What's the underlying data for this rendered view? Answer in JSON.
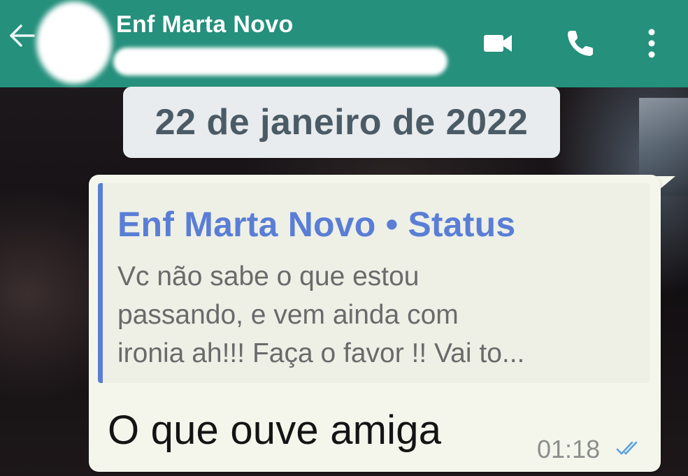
{
  "header": {
    "back_icon": "arrow-left-icon",
    "contact_name": "Enf Marta Novo",
    "actions": [
      {
        "name": "video-call",
        "icon": "video-camera-icon"
      },
      {
        "name": "voice-call",
        "icon": "phone-icon"
      },
      {
        "name": "more-options",
        "icon": "vertical-dots-icon"
      }
    ],
    "bar_color": "#25907c"
  },
  "chat": {
    "date_chip": "22 de janeiro de 2022",
    "message": {
      "quoted": {
        "title": "Enf Marta Novo • Status",
        "lines": [
          "Vc não sabe o que estou",
          "passando, e vem ainda com",
          "ironia ah!!! Faça o favor !! Vai to..."
        ],
        "accent_color": "#5a7ed6"
      },
      "text": "O que ouve amiga",
      "time": "01:18",
      "status_icon": "double-check-icon",
      "status_color": "#5a9fe0"
    }
  }
}
